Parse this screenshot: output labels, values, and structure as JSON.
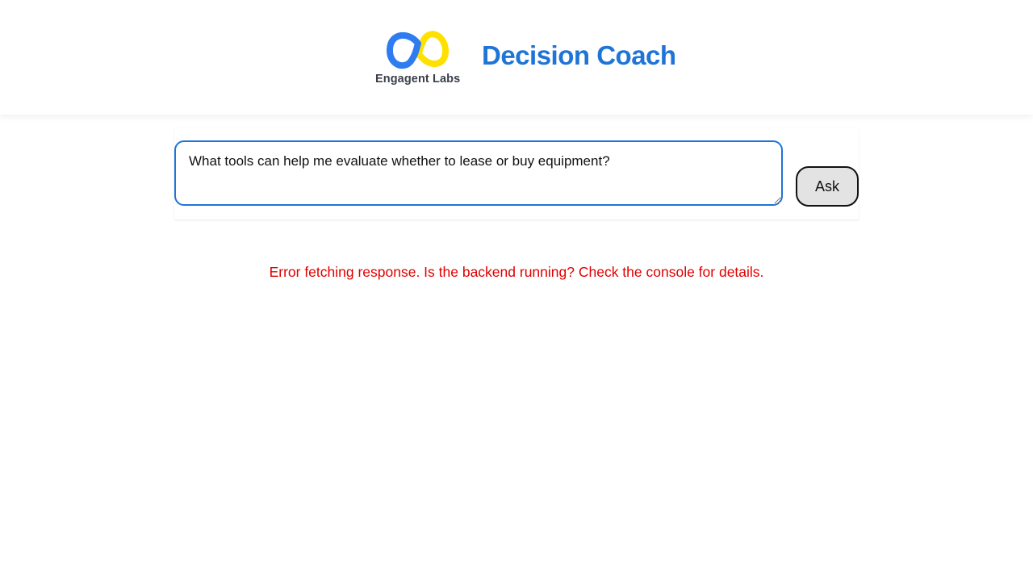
{
  "header": {
    "logo_text": "Engagent Labs",
    "title": "Decision Coach"
  },
  "ask": {
    "question_value": "What tools can help me evaluate whether to lease or buy equipment?",
    "ask_label": "Ask"
  },
  "status": {
    "error": "Error fetching response. Is the backend running? Check the console for details."
  },
  "colors": {
    "brand_blue": "#1f74d8",
    "logo_yellow": "#ffe100",
    "error_red": "#e00000",
    "button_bg": "#e3e3e3"
  },
  "icons": {
    "logo": "two-linked-rings-logo-icon"
  }
}
